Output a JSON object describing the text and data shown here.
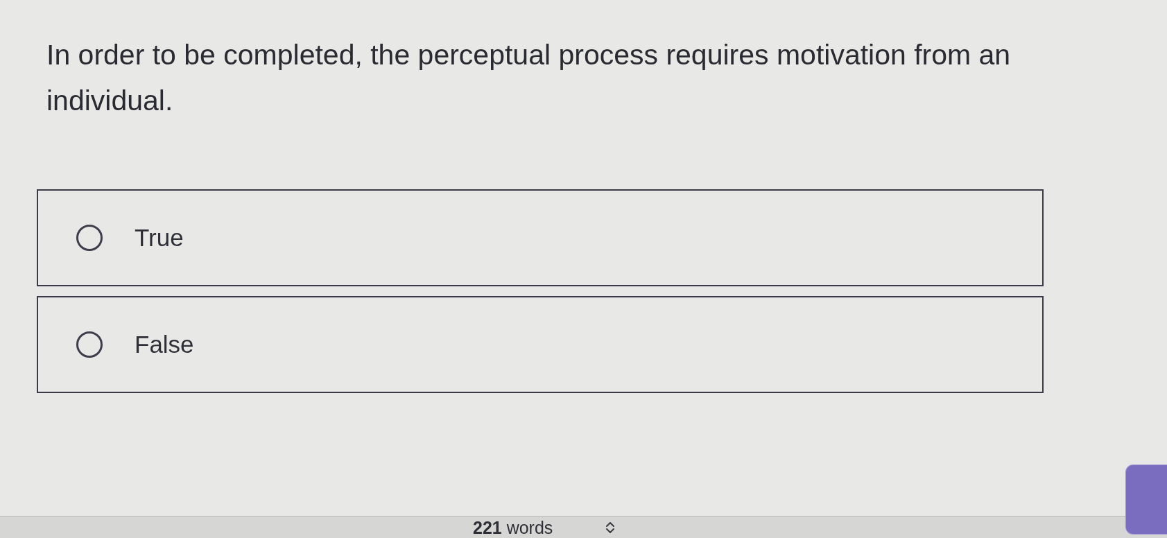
{
  "question": {
    "text": "In order to be completed, the perceptual process requires motivation from an individual."
  },
  "options": [
    {
      "label": "True",
      "selected": false
    },
    {
      "label": "False",
      "selected": false
    }
  ],
  "status_bar": {
    "word_count": "**221** words"
  }
}
